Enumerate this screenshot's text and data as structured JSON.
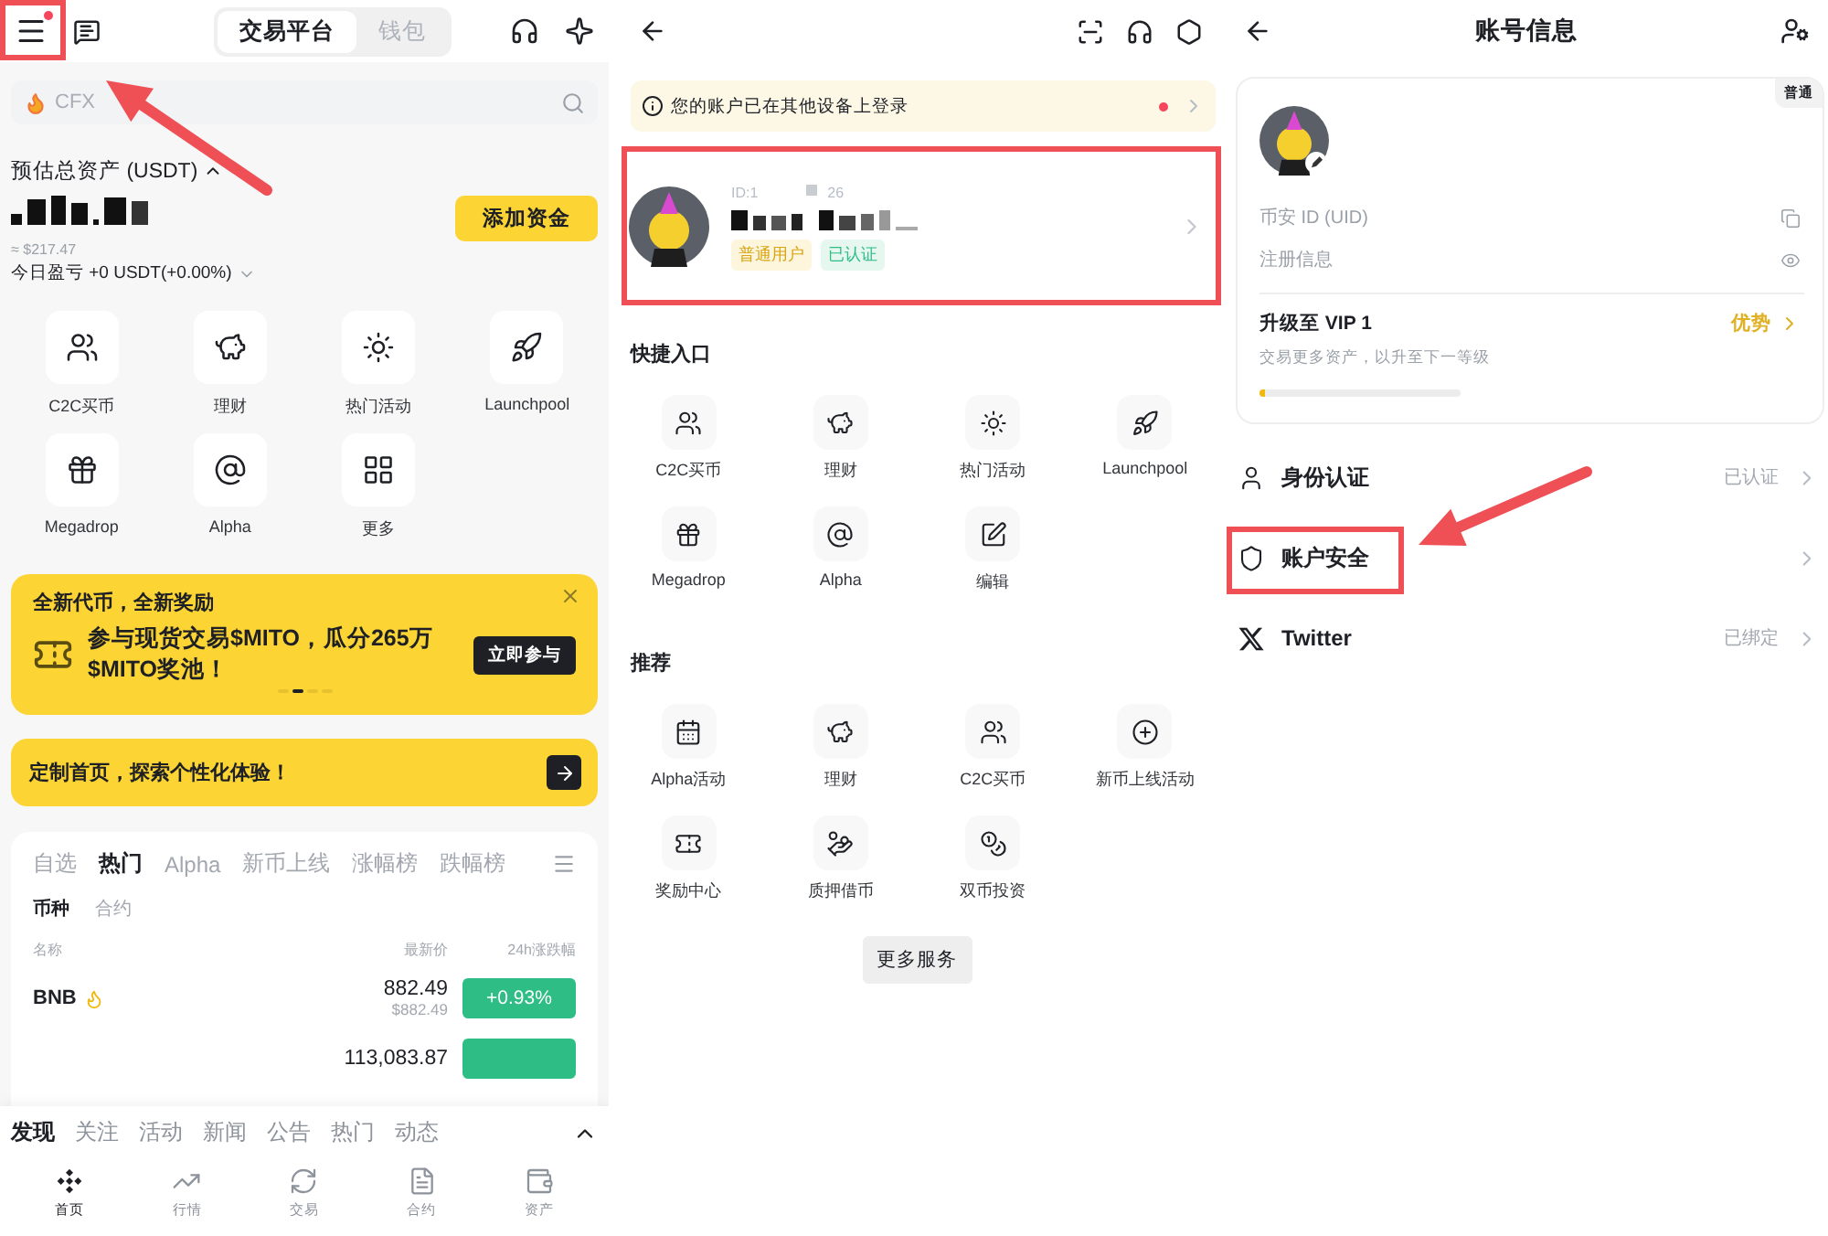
{
  "home": {
    "menu_badge": true,
    "top_tabs": [
      {
        "label": "交易平台",
        "selected": true
      },
      {
        "label": "钱包",
        "selected": false
      }
    ],
    "search": {
      "placeholder": "CFX"
    },
    "assets": {
      "label": "预估总资产 (USDT)",
      "approx": "≈ $217.47",
      "pnl": "今日盈亏 +0 USDT(+0.00%)",
      "add_button": "添加资金"
    },
    "shortcuts": [
      {
        "label": "C2C买币",
        "kind": "c2c"
      },
      {
        "label": "理财",
        "kind": "earn"
      },
      {
        "label": "热门活动",
        "kind": "hot"
      },
      {
        "label": "Launchpool",
        "kind": "launchpool"
      },
      {
        "label": "Megadrop",
        "kind": "megadrop"
      },
      {
        "label": "Alpha",
        "kind": "alpha"
      },
      {
        "label": "更多",
        "kind": "more"
      }
    ],
    "banner": {
      "title": "全新代币，全新奖励",
      "text": "参与现货交易$MITO，瓜分265万$MITO奖池！",
      "button": "立即参与",
      "pager": [
        {
          "selected": false
        },
        {
          "selected": true
        },
        {
          "selected": false
        },
        {
          "selected": false
        }
      ]
    },
    "promo": "定制首页，探索个性化体验！",
    "market": {
      "tabs": [
        {
          "label": "自选",
          "selected": false
        },
        {
          "label": "热门",
          "selected": true
        },
        {
          "label": "Alpha",
          "selected": false
        },
        {
          "label": "新币上线",
          "selected": false
        },
        {
          "label": "涨幅榜",
          "selected": false
        },
        {
          "label": "跌幅榜",
          "selected": false
        }
      ],
      "subtabs": [
        {
          "label": "币种",
          "selected": true
        },
        {
          "label": "合约",
          "selected": false
        }
      ],
      "columns": [
        "名称",
        "最新价",
        "24h涨跌幅"
      ],
      "rows": [
        {
          "name": "BNB",
          "price": "882.49",
          "fiat": "$882.49",
          "change": "+0.93%"
        },
        {
          "price": "113,083.87"
        }
      ]
    },
    "feed_tabs": [
      {
        "label": "发现",
        "selected": true
      },
      {
        "label": "关注",
        "selected": false
      },
      {
        "label": "活动",
        "selected": false
      },
      {
        "label": "新闻",
        "selected": false
      },
      {
        "label": "公告",
        "selected": false
      },
      {
        "label": "热门",
        "selected": false
      },
      {
        "label": "动态",
        "selected": false
      }
    ],
    "nav": [
      {
        "label": "首页",
        "kind": "home",
        "selected": true
      },
      {
        "label": "行情",
        "kind": "market",
        "selected": false
      },
      {
        "label": "交易",
        "kind": "trade",
        "selected": false
      },
      {
        "label": "合约",
        "kind": "futures",
        "selected": false
      },
      {
        "label": "资产",
        "kind": "assets",
        "selected": false
      }
    ]
  },
  "profile": {
    "notice": {
      "text": "您的账户已在其他设备上登录",
      "unread": true
    },
    "user": {
      "id_start": "ID:1",
      "id_end": "26",
      "tags": [
        {
          "label": "普通用户",
          "kind": "level"
        },
        {
          "label": "已认证",
          "kind": "verified"
        }
      ]
    },
    "sections": [
      {
        "title": "快捷入口",
        "items": [
          {
            "label": "C2C买币",
            "kind": "c2c"
          },
          {
            "label": "理财",
            "kind": "earn"
          },
          {
            "label": "热门活动",
            "kind": "hot"
          },
          {
            "label": "Launchpool",
            "kind": "launchpool"
          },
          {
            "label": "Megadrop",
            "kind": "megadrop"
          },
          {
            "label": "Alpha",
            "kind": "alpha"
          },
          {
            "label": "编辑",
            "kind": "edit"
          }
        ]
      },
      {
        "title": "推荐",
        "items": [
          {
            "label": "Alpha活动",
            "kind": "alpha_event"
          },
          {
            "label": "理财",
            "kind": "earn"
          },
          {
            "label": "C2C买币",
            "kind": "c2c"
          },
          {
            "label": "新币上线活动",
            "kind": "new_listing"
          },
          {
            "label": "奖励中心",
            "kind": "rewards"
          },
          {
            "label": "质押借币",
            "kind": "loan"
          },
          {
            "label": "双币投资",
            "kind": "dual"
          }
        ]
      }
    ],
    "more_button": "更多服务"
  },
  "account": {
    "title": "账号信息",
    "badge": "普通",
    "fields": [
      {
        "label": "币安 ID (UID)",
        "kind": "copy"
      },
      {
        "label": "注册信息",
        "kind": "reveal"
      }
    ],
    "vip": {
      "title": "升级至 VIP 1",
      "link": "优势",
      "hint": "交易更多资产，以升至下一等级",
      "level": 0.03
    },
    "rows": [
      {
        "label": "身份认证",
        "kind": "identity",
        "value": "已认证"
      },
      {
        "label": "账户安全",
        "kind": "security"
      },
      {
        "label": "Twitter",
        "kind": "twitter",
        "value": "已绑定"
      }
    ]
  }
}
